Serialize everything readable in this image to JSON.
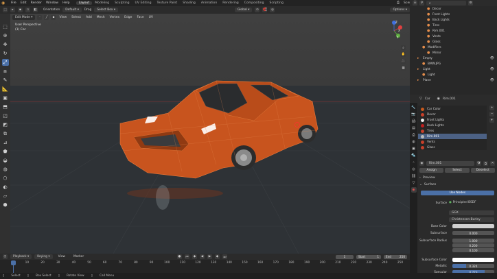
{
  "topbar": {
    "menus": [
      "File",
      "Edit",
      "Render",
      "Window",
      "Help"
    ],
    "workspaces": [
      "Layout",
      "Modeling",
      "Sculpting",
      "UV Editing",
      "Texture Paint",
      "Shading",
      "Animation",
      "Rendering",
      "Compositing",
      "Scripting"
    ],
    "active_workspace": "Layout",
    "scene": "Scene",
    "view_layer": "View Layer"
  },
  "header": {
    "orientation": "Orientation",
    "orientation_value": "Default",
    "drag": "Drag",
    "drag_value": "Select Box",
    "transform": "Global",
    "options": "Options"
  },
  "viewport": {
    "mode": "Edit Mode",
    "menus": [
      "View",
      "Select",
      "Add",
      "Mesh",
      "Vertex",
      "Edge",
      "Face",
      "UV"
    ],
    "overlay_title": "User Perspective",
    "overlay_object": "(1) Car",
    "gizmo": {
      "x": "X",
      "y": "Y",
      "z": "Z"
    }
  },
  "outliner": {
    "items": [
      {
        "label": "Decor",
        "indent": 3
      },
      {
        "label": "Front Lights",
        "indent": 3
      },
      {
        "label": "Back Lights",
        "indent": 3
      },
      {
        "label": "Tires",
        "indent": 3
      },
      {
        "label": "Rim.001",
        "indent": 3
      },
      {
        "label": "Vents",
        "indent": 3
      },
      {
        "label": "Glass",
        "indent": 3
      },
      {
        "label": "Modifiers",
        "indent": 2
      },
      {
        "label": "Mirror",
        "indent": 3
      },
      {
        "label": "Empty",
        "indent": 1
      },
      {
        "label": "BMW.JPG",
        "indent": 2
      },
      {
        "label": "Light",
        "indent": 1
      },
      {
        "label": "Light",
        "indent": 2
      },
      {
        "label": "Plane",
        "indent": 1
      }
    ]
  },
  "properties": {
    "object": "Car",
    "material": "Rim.001",
    "slots": [
      {
        "label": "Car Color",
        "color": "#c85a1e"
      },
      {
        "label": "Decor",
        "color": "#c8402a"
      },
      {
        "label": "Front Lights",
        "color": "#f0f0f0"
      },
      {
        "label": "Back Lights",
        "color": "#c02020"
      },
      {
        "label": "Tires",
        "color": "#c8402a"
      },
      {
        "label": "Rim.001",
        "color": "#bbbbbb"
      },
      {
        "label": "Vents",
        "color": "#c8402a"
      },
      {
        "label": "Glass",
        "color": "#c8402a"
      }
    ],
    "selected_slot": "Rim.001",
    "mat_field": "Rim.001",
    "assign": "Assign",
    "select": "Select",
    "deselect": "Deselect",
    "preview": "Preview",
    "surface_section": "Surface",
    "use_nodes": "Use Nodes",
    "surface_label": "Surface",
    "surface_value": "Principled BSDF",
    "distribution": "GGX",
    "subsurface_method": "Christensen-Burley",
    "base_color_label": "Base Color",
    "base_color": "#d0d0d0",
    "subsurface_label": "Subsurface",
    "subsurface_value": "0.000",
    "subsurface_radius_label": "Subsurface Radius",
    "subsurface_radius": [
      "1.000",
      "0.200",
      "0.100"
    ],
    "subsurface_color_label": "Subsurface Color",
    "subsurface_color": "#ffffff",
    "metallic_label": "Metallic",
    "metallic_value": "0.324",
    "specular_label": "Specular",
    "specular_value": "0.773"
  },
  "timeline": {
    "menus": [
      "Playback",
      "Keying",
      "View",
      "Marker"
    ],
    "current_frame": "1",
    "start_label": "Start",
    "start": "1",
    "end_label": "End",
    "end": "250",
    "ticks": [
      "1",
      "10",
      "20",
      "30",
      "40",
      "50",
      "60",
      "70",
      "80",
      "90",
      "100",
      "110",
      "120",
      "130",
      "140",
      "150",
      "160",
      "170",
      "180",
      "190",
      "200",
      "210",
      "220",
      "230",
      "240",
      "250"
    ]
  },
  "status": {
    "items": [
      "Select",
      "Box Select",
      "Rotate View",
      "Call Menu"
    ]
  },
  "colors": {
    "accent": "#4b70a7",
    "car": "#c8541e"
  }
}
